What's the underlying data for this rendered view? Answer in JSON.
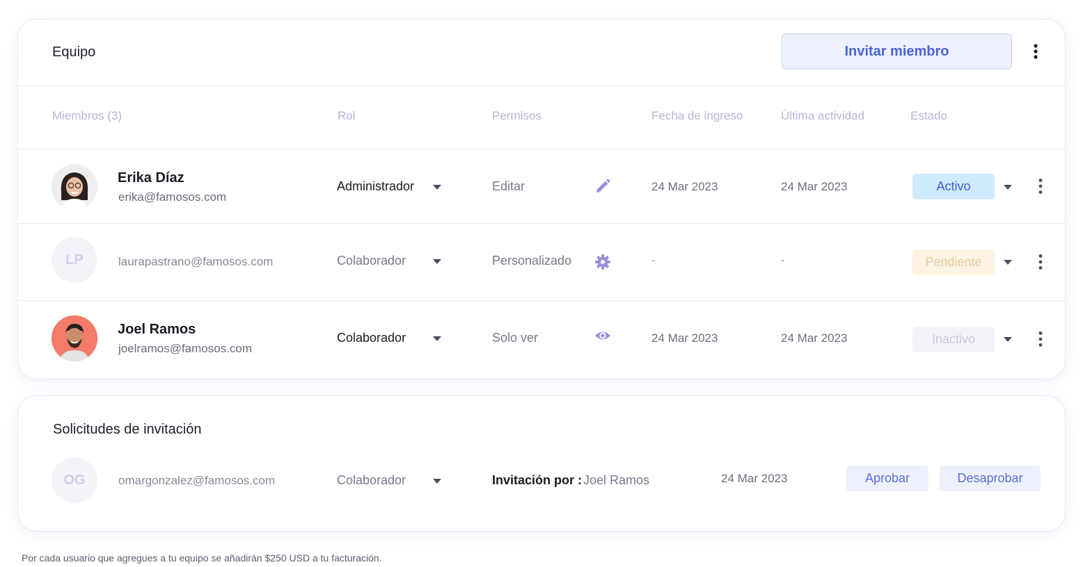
{
  "team": {
    "title": "Equipo",
    "invite_label": "Invitar miembro",
    "columns": {
      "members": "Miembros (3)",
      "role": "Rol",
      "permissions": "Permisos",
      "join_date": "Fecha de ingreso",
      "last_activity": "Última actividad",
      "status": "Estado"
    },
    "members": [
      {
        "name": "Erika Díaz",
        "email": "erika@famosos.com",
        "role": "Administrador",
        "permission": "Editar",
        "permission_icon": "pencil-icon",
        "join_date": "24 Mar 2023",
        "last_activity": "24 Mar 2023",
        "status": "Activo"
      },
      {
        "initials": "LP",
        "email": "laurapastrano@famosos.com",
        "role": "Colaborador",
        "permission": "Personalizado",
        "permission_icon": "gear-icon",
        "join_date": "-",
        "last_activity": "-",
        "status": "Pendiente"
      },
      {
        "name": "Joel Ramos",
        "email": "joelramos@famosos.com",
        "role": "Colaborador",
        "permission": "Solo ver",
        "permission_icon": "eye-icon",
        "join_date": "24 Mar 2023",
        "last_activity": "24 Mar 2023",
        "status": "Inactivo"
      }
    ]
  },
  "requests": {
    "title": "Solicitudes de invitación",
    "items": [
      {
        "initials": "OG",
        "email": "omargonzalez@famosos.com",
        "role": "Colaborador",
        "invited_by_label": "Invitación por :",
        "invited_by": "Joel Ramos",
        "date": "24 Mar 2023",
        "approve_label": "Aprobar",
        "reject_label": "Desaprobar"
      }
    ]
  },
  "footnote": "Por cada usuario que agregues a tu equipo se añadirán $250 USD a tu facturación.",
  "colors": {
    "accent": "#4a63d8",
    "active_bg": "#cfe9fd",
    "pending_bg": "#fdf4e3",
    "inactive_bg": "#f4f3fa",
    "avatar_joel_bg": "#f47a6a"
  }
}
